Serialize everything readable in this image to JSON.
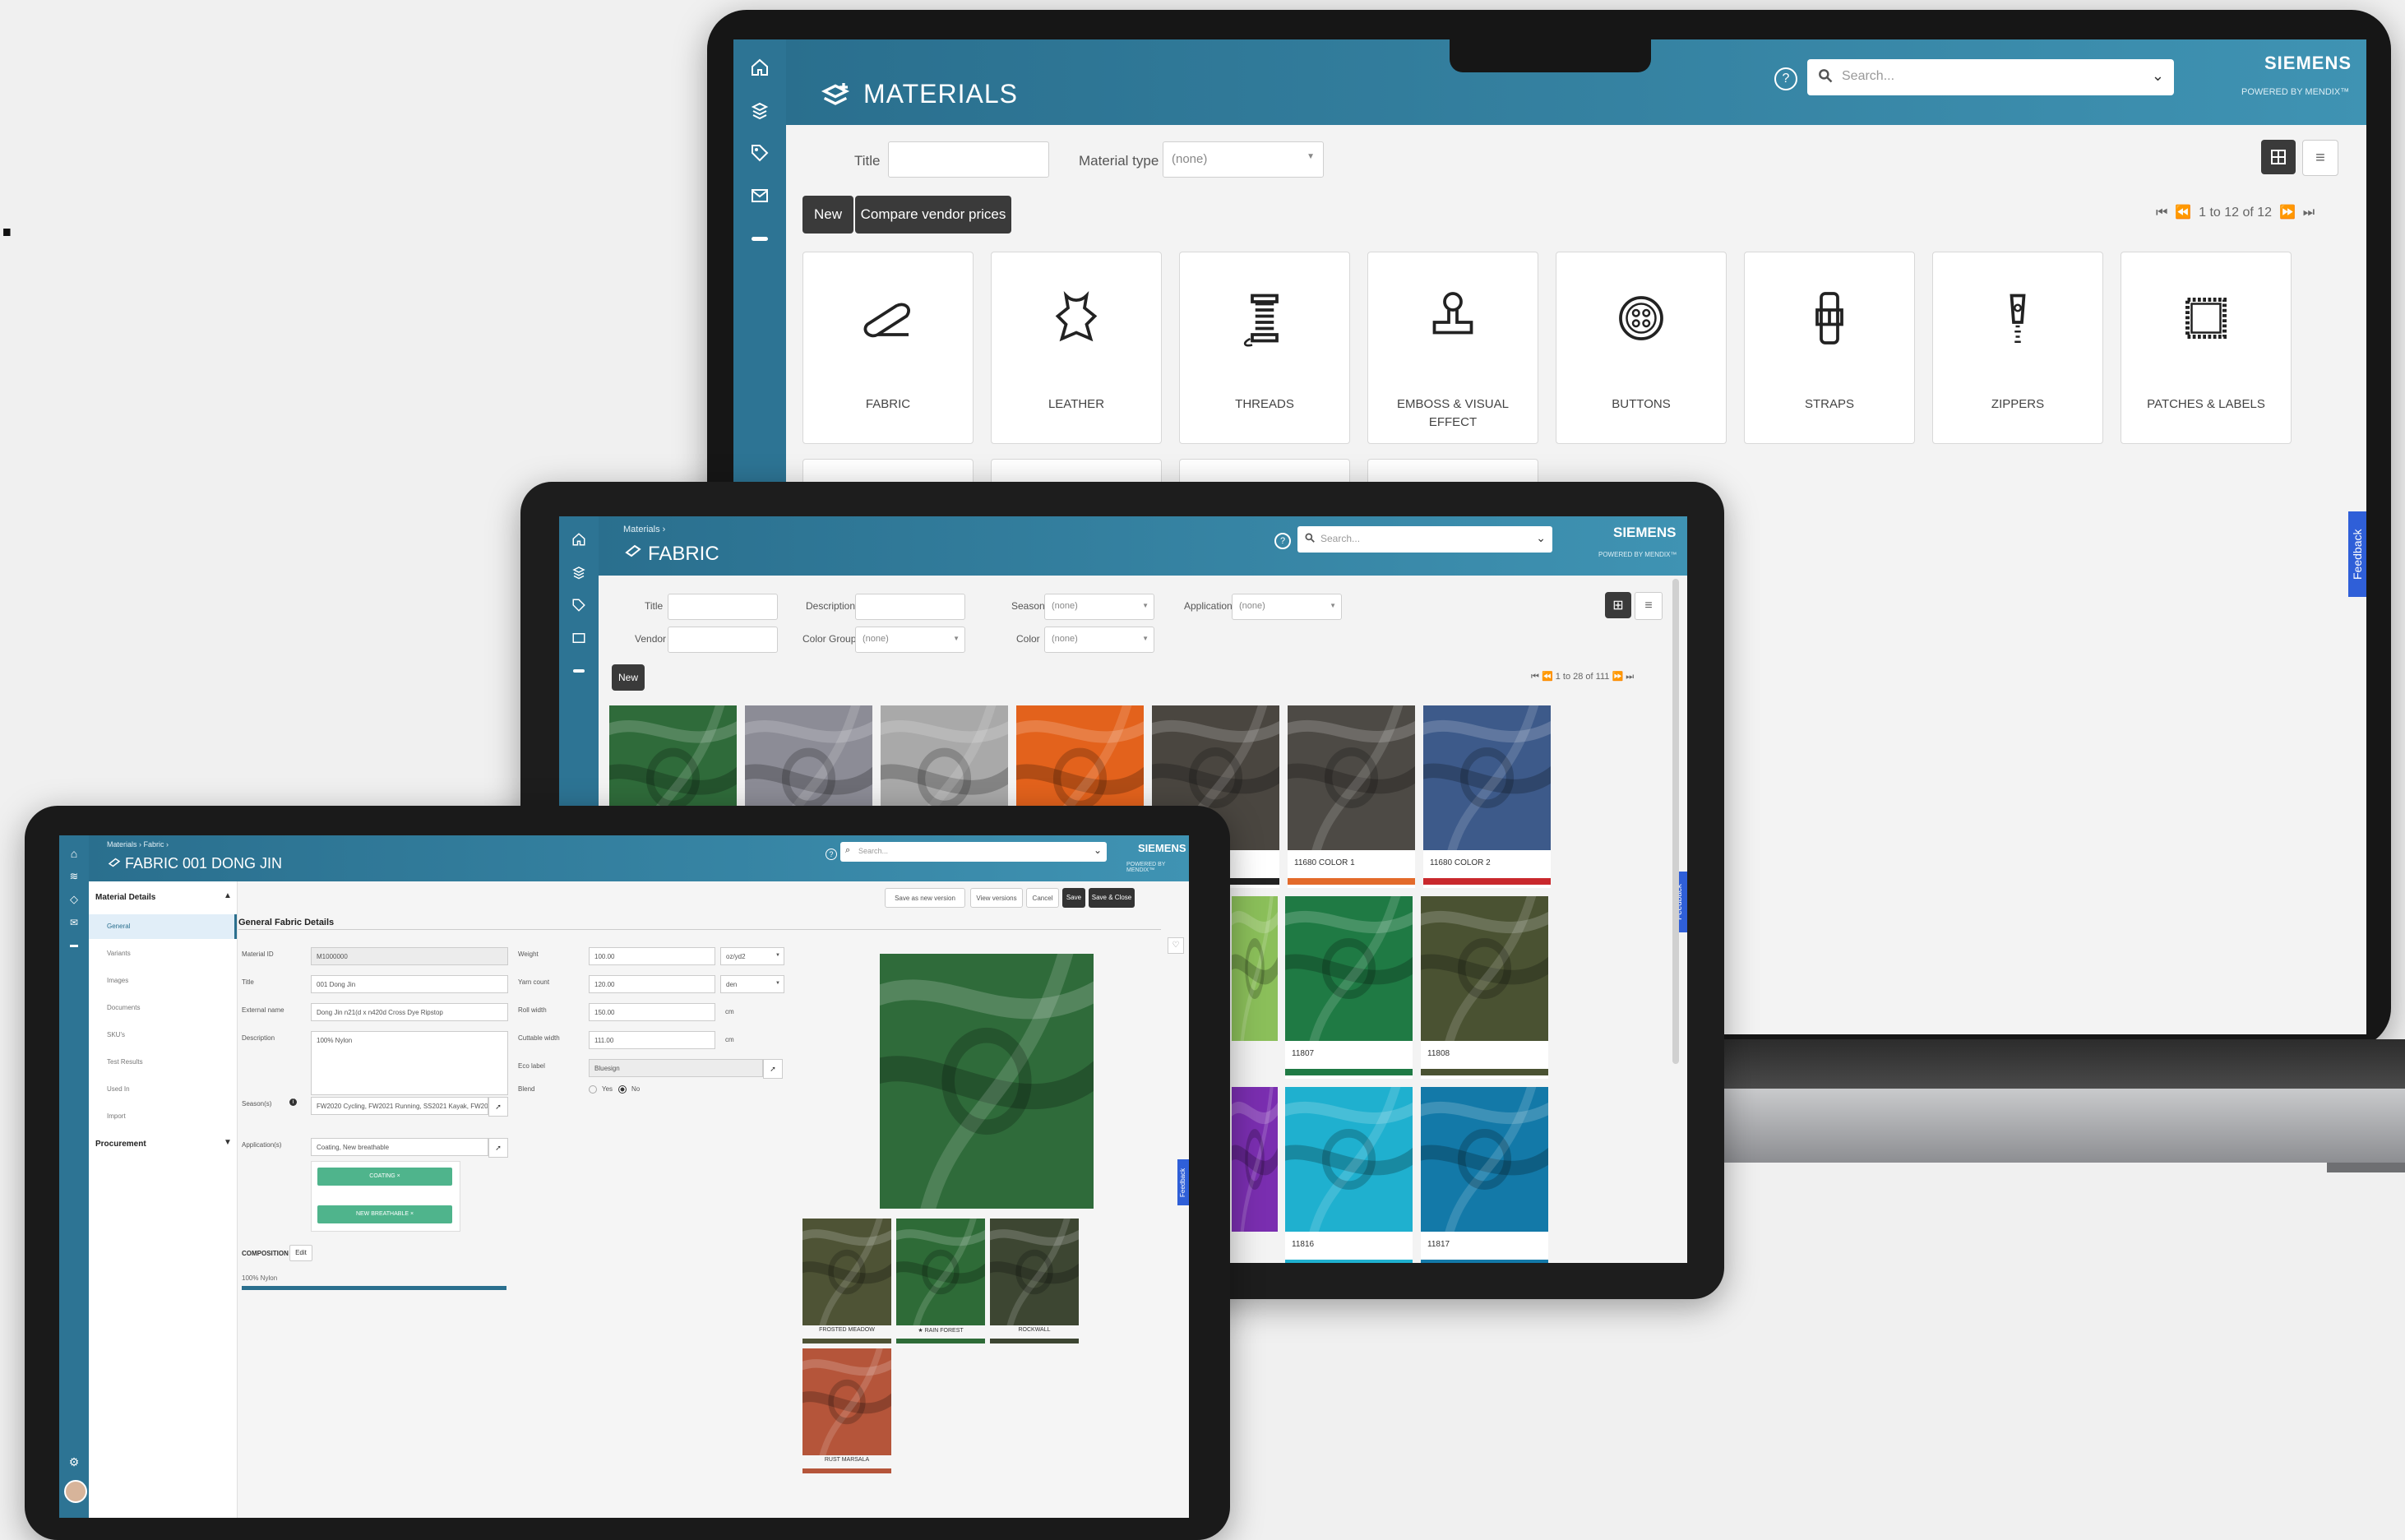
{
  "laptop": {
    "logo": "SIEMENS",
    "powered": "POWERED BY MENDIX™",
    "page_title": "MATERIALS",
    "search_placeholder": "Search...",
    "filters": {
      "title_label": "Title",
      "material_type_label": "Material type",
      "material_type_value": "(none)"
    },
    "buttons": {
      "new": "New",
      "compare": "Compare vendor prices"
    },
    "pagination": "1 to 12 of 12",
    "feedback": "Feedback",
    "categories": [
      {
        "label": "FABRIC",
        "icon": "fabric-roll-icon"
      },
      {
        "label": "LEATHER",
        "icon": "leather-hide-icon"
      },
      {
        "label": "THREADS",
        "icon": "thread-spool-icon"
      },
      {
        "label": "EMBOSS & VISUAL EFFECT",
        "icon": "stamp-icon"
      },
      {
        "label": "BUTTONS",
        "icon": "button-icon"
      },
      {
        "label": "STRAPS",
        "icon": "strap-buckle-icon"
      },
      {
        "label": "ZIPPERS",
        "icon": "zipper-icon"
      },
      {
        "label": "PATCHES & LABELS",
        "icon": "patch-icon"
      }
    ]
  },
  "tablet": {
    "logo": "SIEMENS",
    "powered": "POWERED BY MENDIX™",
    "breadcrumb": "Materials  ›",
    "page_title": "FABRIC",
    "search_placeholder": "Search...",
    "filters": {
      "title": "Title",
      "description": "Description",
      "season": "Season",
      "season_value": "(none)",
      "application": "Application",
      "application_value": "(none)",
      "vendor": "Vendor",
      "color_group": "Color Group",
      "color_group_value": "(none)",
      "color": "Color",
      "color_value": "(none)"
    },
    "new_button": "New",
    "pagination": "1 to 28 of 111",
    "feedback": "Feedback",
    "swatches": [
      {
        "label": "",
        "color": "#2f6b3a"
      },
      {
        "label": "",
        "color": "#8c8c96"
      },
      {
        "label": "",
        "color": "#a9a9a9"
      },
      {
        "label": "",
        "color": "#e3621c"
      },
      {
        "label": "",
        "color": "#4a4640"
      },
      {
        "label": "11680 COLOR 1",
        "color": "#4d4a45"
      },
      {
        "label": "11680 COLOR 2",
        "color": "#3d5a8a"
      },
      {
        "label": "11807",
        "color": "#1f7a44"
      },
      {
        "label": "11808",
        "color": "#4a5232"
      },
      {
        "label": "11816",
        "color": "#1fb0cf"
      },
      {
        "label": "11817",
        "color": "#1379a8"
      }
    ]
  },
  "ipad": {
    "logo": "SIEMENS",
    "powered": "POWERED BY MENDIX™",
    "breadcrumb": "Materials  ›  Fabric  ›",
    "page_title": "FABRIC 001 DONG JIN",
    "search_placeholder": "Search...",
    "actions": [
      "Save as new version",
      "View versions",
      "Cancel",
      "Save",
      "Save & Close"
    ],
    "nav": {
      "section1": "Material Details",
      "items": [
        "General",
        "Variants",
        "Images",
        "Documents",
        "SKU's",
        "Test Results",
        "Used In",
        "Import"
      ],
      "section2": "Procurement"
    },
    "section_title": "General Fabric Details",
    "fields_left": [
      {
        "label": "Material ID",
        "value": "M1000000"
      },
      {
        "label": "Title",
        "value": "001 Dong Jin"
      },
      {
        "label": "External name",
        "value": "Dong Jin n21(d x n420d Cross Dye Ripstop"
      },
      {
        "label": "Description",
        "value": "100% Nylon"
      },
      {
        "label": "Season(s)",
        "value": "FW2020 Cycling, FW2021 Running, SS2021 Kayak, FW2024"
      },
      {
        "label": "Application(s)",
        "value": "Coating, New breathable"
      }
    ],
    "tags": [
      "COATING  ×",
      "NEW BREATHABLE  ×"
    ],
    "composition_label": "COMPOSITION",
    "composition_edit": "Edit",
    "composition_value": "100% Nylon",
    "fields_right": [
      {
        "label": "Weight",
        "value": "100.00",
        "unit": "oz/yd2"
      },
      {
        "label": "Yarn count",
        "value": "120.00",
        "unit": "den"
      },
      {
        "label": "Roll width",
        "value": "150.00",
        "unit": "cm"
      },
      {
        "label": "Cuttable width",
        "value": "111.00",
        "unit": "cm"
      },
      {
        "label": "Eco label",
        "value": "Bluesign",
        "unit": ""
      }
    ],
    "blend_label": "Blend",
    "blend_yes": "Yes",
    "blend_no": "No",
    "variants": [
      {
        "label": "FROSTED MEADOW",
        "color": "#4e5335"
      },
      {
        "label": "★ RAIN FOREST",
        "color": "#2e6b37"
      },
      {
        "label": "ROCKWALL",
        "color": "#3d4632"
      },
      {
        "label": "RUST MARSALA",
        "color": "#b5553a"
      }
    ],
    "feedback": "Feedback"
  },
  "edge_text": "."
}
